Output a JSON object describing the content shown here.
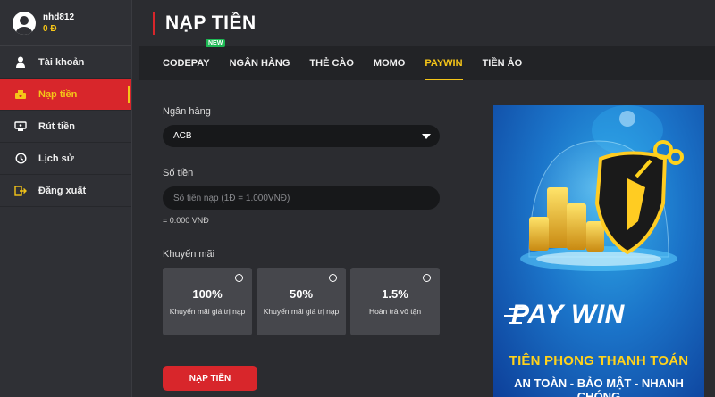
{
  "user": {
    "username": "nhd812",
    "balance": "0 Đ"
  },
  "sidebar": {
    "items": [
      {
        "label": "Tài khoản",
        "icon": "user-icon"
      },
      {
        "label": "Nạp tiền",
        "icon": "deposit-icon",
        "active": true
      },
      {
        "label": "Rút tiền",
        "icon": "withdraw-icon"
      },
      {
        "label": "Lịch sử",
        "icon": "history-icon"
      },
      {
        "label": "Đăng xuất",
        "icon": "logout-icon"
      }
    ]
  },
  "header": {
    "title": "NẠP TIỀN"
  },
  "tabs": [
    {
      "label": "CODEPAY",
      "badge": "NEW"
    },
    {
      "label": "NGÂN HÀNG"
    },
    {
      "label": "THẺ CÀO"
    },
    {
      "label": "MOMO"
    },
    {
      "label": "PAYWIN",
      "active": true
    },
    {
      "label": "TIỀN ẢO"
    }
  ],
  "form": {
    "bank_label": "Ngân hàng",
    "bank_value": "ACB",
    "amount_label": "Số tiền",
    "amount_placeholder": "Số tiền nạp (1Đ = 1.000VNĐ)",
    "amount_value": "",
    "converted": "= 0.000 VNĐ",
    "promo_label": "Khuyến mãi",
    "promos": [
      {
        "value": "100%",
        "desc": "Khuyến mãi giá trị nạp"
      },
      {
        "value": "50%",
        "desc": "Khuyến mãi giá trị nạp"
      },
      {
        "value": "1.5%",
        "desc": "Hoàn trả vô tận"
      }
    ],
    "submit_label": "NẠP TIỀN"
  },
  "banner": {
    "logo": "PAY WIN",
    "tagline": "TIÊN PHONG THANH TOÁN",
    "subtagline": "AN TOÀN - BẢO MẬT - NHANH CHÓNG"
  },
  "colors": {
    "accent_red": "#d8262b",
    "accent_yellow": "#f5c518",
    "badge_green": "#1db954"
  }
}
